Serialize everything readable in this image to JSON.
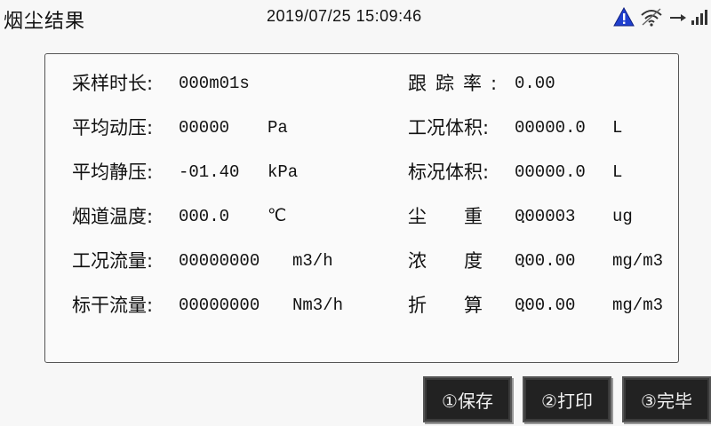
{
  "header": {
    "title": "烟尘结果",
    "datetime": "2019/07/25 15:09:46",
    "icons": [
      "warning-icon",
      "wifi-icon",
      "signal-icon"
    ]
  },
  "results": {
    "left": [
      {
        "label": "采样时长:",
        "value": "000m01s",
        "unit": ""
      },
      {
        "label": "平均动压:",
        "value": "00000",
        "unit": "Pa"
      },
      {
        "label": "平均静压:",
        "value": "-01.40",
        "unit": "kPa"
      },
      {
        "label": "烟道温度:",
        "value": "000.0",
        "unit": "℃"
      },
      {
        "label": "工况流量:",
        "value": "00000000",
        "unit": "m3/h"
      },
      {
        "label": "标干流量:",
        "value": "00000000",
        "unit": "Nm3/h"
      }
    ],
    "right": [
      {
        "label": "跟踪率:",
        "value": "0.00",
        "unit": ""
      },
      {
        "label": "工况体积:",
        "value": "00000.0",
        "unit": "L"
      },
      {
        "label": "标况体积:",
        "value": "00000.0",
        "unit": "L"
      },
      {
        "label": "尘重:",
        "value": "000003",
        "unit": "ug"
      },
      {
        "label": "浓度:",
        "value": "000.00",
        "unit": "mg/m3"
      },
      {
        "label": "折算:",
        "value": "000.00",
        "unit": "mg/m3"
      }
    ]
  },
  "buttons": {
    "save": "①保存",
    "print": "②打印",
    "done": "③完毕"
  },
  "colors": {
    "background": "#f7f7f7",
    "button_bg": "#222222",
    "button_text": "#f2f2f2",
    "warning_icon": "#1f3fcf"
  }
}
